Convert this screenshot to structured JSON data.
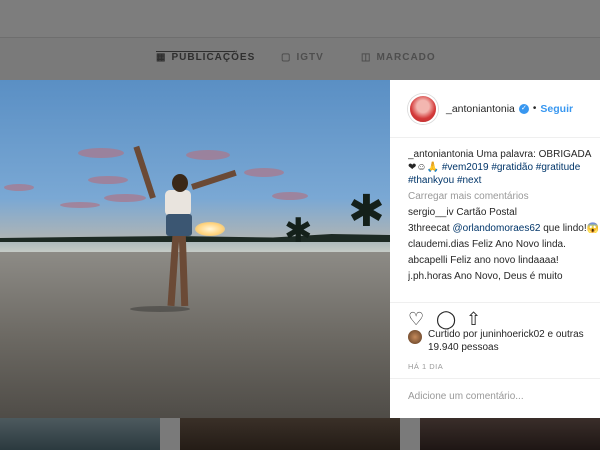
{
  "tabs": [
    {
      "label": "PUBLICAÇÕES",
      "icon": "grid-icon",
      "active": true
    },
    {
      "label": "IGTV",
      "icon": "igtv-icon",
      "active": false
    },
    {
      "label": "MARCADO",
      "icon": "tagged-icon",
      "active": false
    }
  ],
  "post": {
    "username": "_antoniantonia",
    "verified": true,
    "follow_label": "Seguir",
    "caption_user": "_antoniantonia",
    "caption_text": "Uma palavra: OBRIGADA",
    "caption_emojis": "❤☺🙏",
    "hashtags": [
      "#vem2019",
      "#gratidão",
      "#gratitude",
      "#thankyou",
      "#next"
    ],
    "load_more_label": "Carregar mais comentários",
    "comments": [
      {
        "user": "sergio__iv",
        "text": "Cartão Postal"
      },
      {
        "user": "3threecat",
        "mention": "@orlandomoraes62",
        "text": "que lindo!😱"
      },
      {
        "user": "claudemi.dias",
        "text": "Feliz Ano Novo linda."
      },
      {
        "user": "abcapelli",
        "text": "Feliz ano novo lindaaaa!"
      },
      {
        "user": "j.ph.horas",
        "text": "Ano Novo, Deus é muito"
      }
    ],
    "liked_by_text": "Curtido por juninhoerick02 e outras 19.940 pessoas",
    "date": "HÁ 1 DIA",
    "add_comment_placeholder": "Adicione um comentário..."
  },
  "colors": {
    "link_blue": "#3897f0",
    "hashtag_blue": "#003569",
    "muted_grey": "#999999"
  }
}
